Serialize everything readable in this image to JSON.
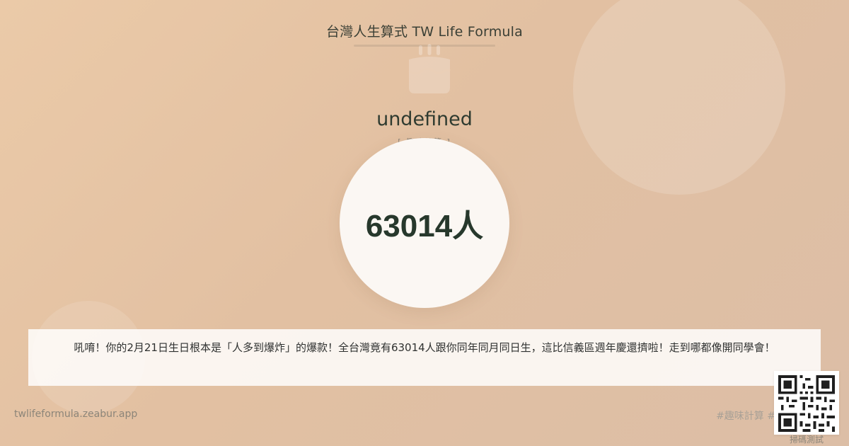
{
  "header": {
    "brand_title": "台灣人生算式 TW Life Formula",
    "decor_icon": "birthday-cake-icon"
  },
  "result": {
    "title": "undefined",
    "subtitle": "[ 趣味計算 ]",
    "value": "63014人"
  },
  "message": {
    "text": "吼唷！你的2月21日生日根本是「人多到爆炸」的爆款！全台灣竟有63014人跟你同年同月同日生，這比信義區週年慶還擠啦！走到哪都像開同學會！"
  },
  "footer": {
    "site_url": "twlifeformula.zeabur.app",
    "hashtags": "#趣味計算 #台灣人生算式",
    "qr_label": "掃碼測試"
  },
  "colors": {
    "background_start": "#ebcaa8",
    "background_end": "#dcbea6",
    "accent_dark": "#27382c",
    "card": "#fbf7f3"
  }
}
